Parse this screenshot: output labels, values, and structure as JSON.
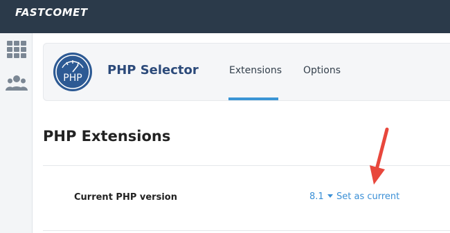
{
  "topbar": {
    "brand": "FASTCOMET"
  },
  "sidebar": {
    "items": [
      {
        "icon": "grid-icon"
      },
      {
        "icon": "users-icon"
      }
    ]
  },
  "header": {
    "app_title": "PHP Selector",
    "logo_text": "PHP",
    "tabs": [
      {
        "label": "Extensions",
        "active": true
      },
      {
        "label": "Options",
        "active": false
      }
    ]
  },
  "main": {
    "section_title": "PHP Extensions",
    "current_version_label": "Current PHP version",
    "version_value": "8.1",
    "set_current_label": "Set as current"
  },
  "colors": {
    "topbar": "#2b3a4a",
    "accent": "#3a95d5",
    "link": "#3a8fd6",
    "annotation_arrow": "#e8473c",
    "title": "#2c4a7a"
  }
}
